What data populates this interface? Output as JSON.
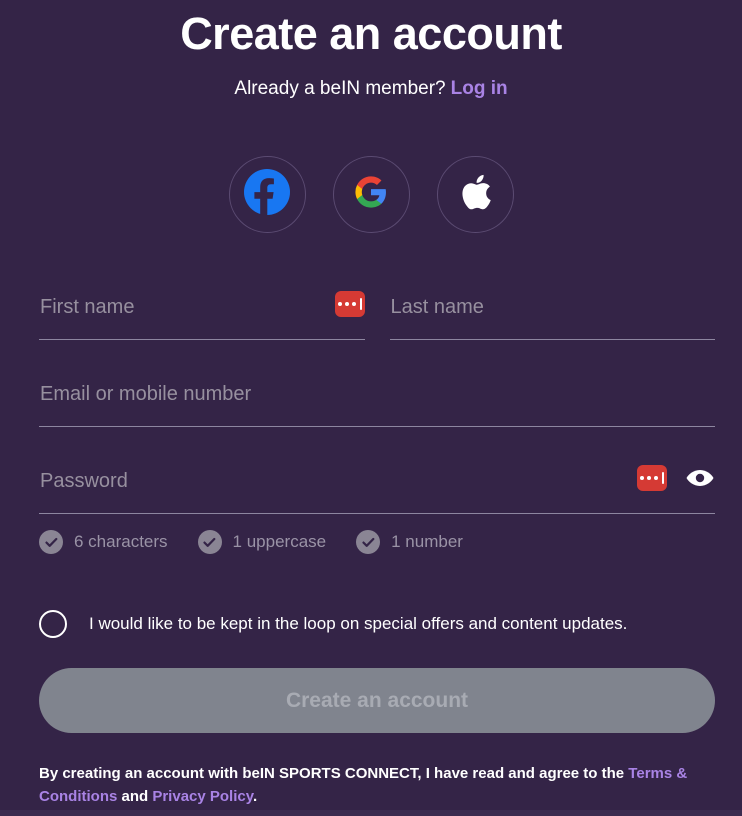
{
  "header": {
    "title": "Create an account",
    "member_prompt": "Already a beIN member?",
    "login_label": "Log in"
  },
  "social": {
    "buttons": [
      {
        "name": "facebook",
        "label": "Facebook"
      },
      {
        "name": "google",
        "label": "Google"
      },
      {
        "name": "apple",
        "label": "Apple"
      }
    ]
  },
  "form": {
    "first_name": {
      "placeholder": "First name",
      "value": ""
    },
    "last_name": {
      "placeholder": "Last name",
      "value": ""
    },
    "email": {
      "placeholder": "Email or mobile number",
      "value": ""
    },
    "password": {
      "placeholder": "Password",
      "value": ""
    },
    "password_manager_icon": "lastpass-icon",
    "show_password_icon": "eye-icon"
  },
  "password_rules": [
    {
      "label": "6 characters",
      "met": true
    },
    {
      "label": "1 uppercase",
      "met": true
    },
    {
      "label": "1 number",
      "met": true
    }
  ],
  "optin": {
    "label": "I would like to be kept in the loop on special offers and content updates.",
    "checked": false
  },
  "submit": {
    "label": "Create an account",
    "enabled": false
  },
  "legal": {
    "part1": "By creating an account with beIN SPORTS CONNECT, I have read and agree to the ",
    "terms_link": "Terms & Conditions",
    "conjunction": " and ",
    "privacy_link": "Privacy Policy",
    "period": "."
  },
  "colors": {
    "background": "#342447",
    "accent_purple": "#a983e5",
    "placeholder": "#97909f",
    "field_underline": "#8d86a0",
    "button_disabled_bg": "#80848e",
    "button_disabled_text": "#a8abb3",
    "lastpass_red": "#d53a34",
    "facebook_blue": "#1877f2"
  }
}
